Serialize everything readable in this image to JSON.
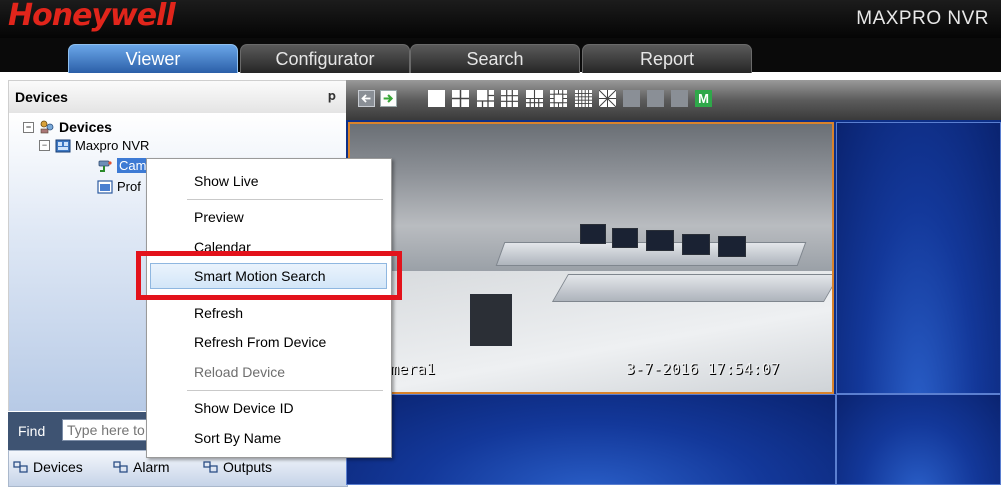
{
  "app": {
    "brand": "Honeywell",
    "product": "MAXPRO NVR",
    "brand_color": "#e1251b"
  },
  "tabs": [
    {
      "label": "Viewer",
      "active": true
    },
    {
      "label": "Configurator",
      "active": false
    },
    {
      "label": "Search",
      "active": false
    },
    {
      "label": "Report",
      "active": false
    }
  ],
  "devices_panel": {
    "title": "Devices",
    "pin_icon": "pin-icon",
    "tree": [
      {
        "label": "Devices",
        "icon": "devices-root-icon",
        "expander": "−"
      },
      {
        "label": "Maxpro NVR",
        "icon": "nvr-icon",
        "expander": "−"
      },
      {
        "label": "Cam",
        "icon": "camera-icon",
        "selected": true
      },
      {
        "label": "Prof",
        "icon": "profile-icon"
      }
    ],
    "find_label": "Find",
    "find_placeholder": "Type here to",
    "bottom_tabs": [
      "Devices",
      "Alarm",
      "Outputs"
    ]
  },
  "toolbar": {
    "m_button": "M"
  },
  "camera_view": {
    "camera_name": "mera1",
    "timestamp": "3-7-2016 17:54:07",
    "border_color": "#d9832b"
  },
  "context_menu": {
    "items": [
      {
        "label": "Show Live"
      },
      {
        "label": "Preview"
      },
      {
        "label": "Calendar"
      },
      {
        "label": "Smart Motion Search",
        "highlighted": true
      },
      {
        "label": "Refresh"
      },
      {
        "label": "Refresh From Device"
      },
      {
        "label": "Reload Device",
        "disabled": true
      },
      {
        "label": "Show Device ID"
      },
      {
        "label": "Sort By Name"
      }
    ],
    "callout_color": "#e3121b"
  }
}
